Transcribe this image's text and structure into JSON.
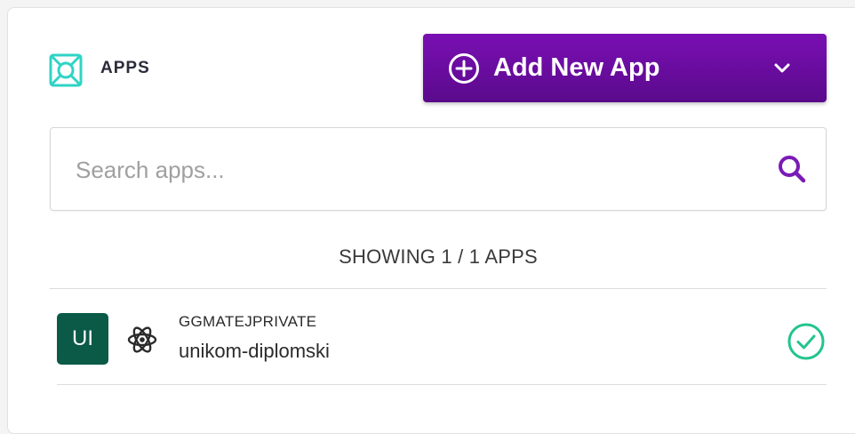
{
  "header": {
    "title": "APPS",
    "icon": "apps-icon",
    "icon_color": "#2fd4c6"
  },
  "add_button": {
    "label": "Add New App",
    "icon": "plus-circle-icon",
    "dropdown_icon": "chevron-down-icon",
    "color": "#6b0ea3"
  },
  "search": {
    "placeholder": "Search apps...",
    "value": "",
    "icon": "search-icon",
    "icon_color": "#7a1bb5"
  },
  "summary": {
    "text": "SHOWING 1 / 1 APPS"
  },
  "apps": [
    {
      "avatar_text": "UI",
      "avatar_color": "#0b5a48",
      "framework_icon": "react-icon",
      "owner": "GGMATEJPRIVATE",
      "name": "unikom-diplomski",
      "status_icon": "check-circle-icon",
      "status_color": "#23c48e"
    }
  ]
}
